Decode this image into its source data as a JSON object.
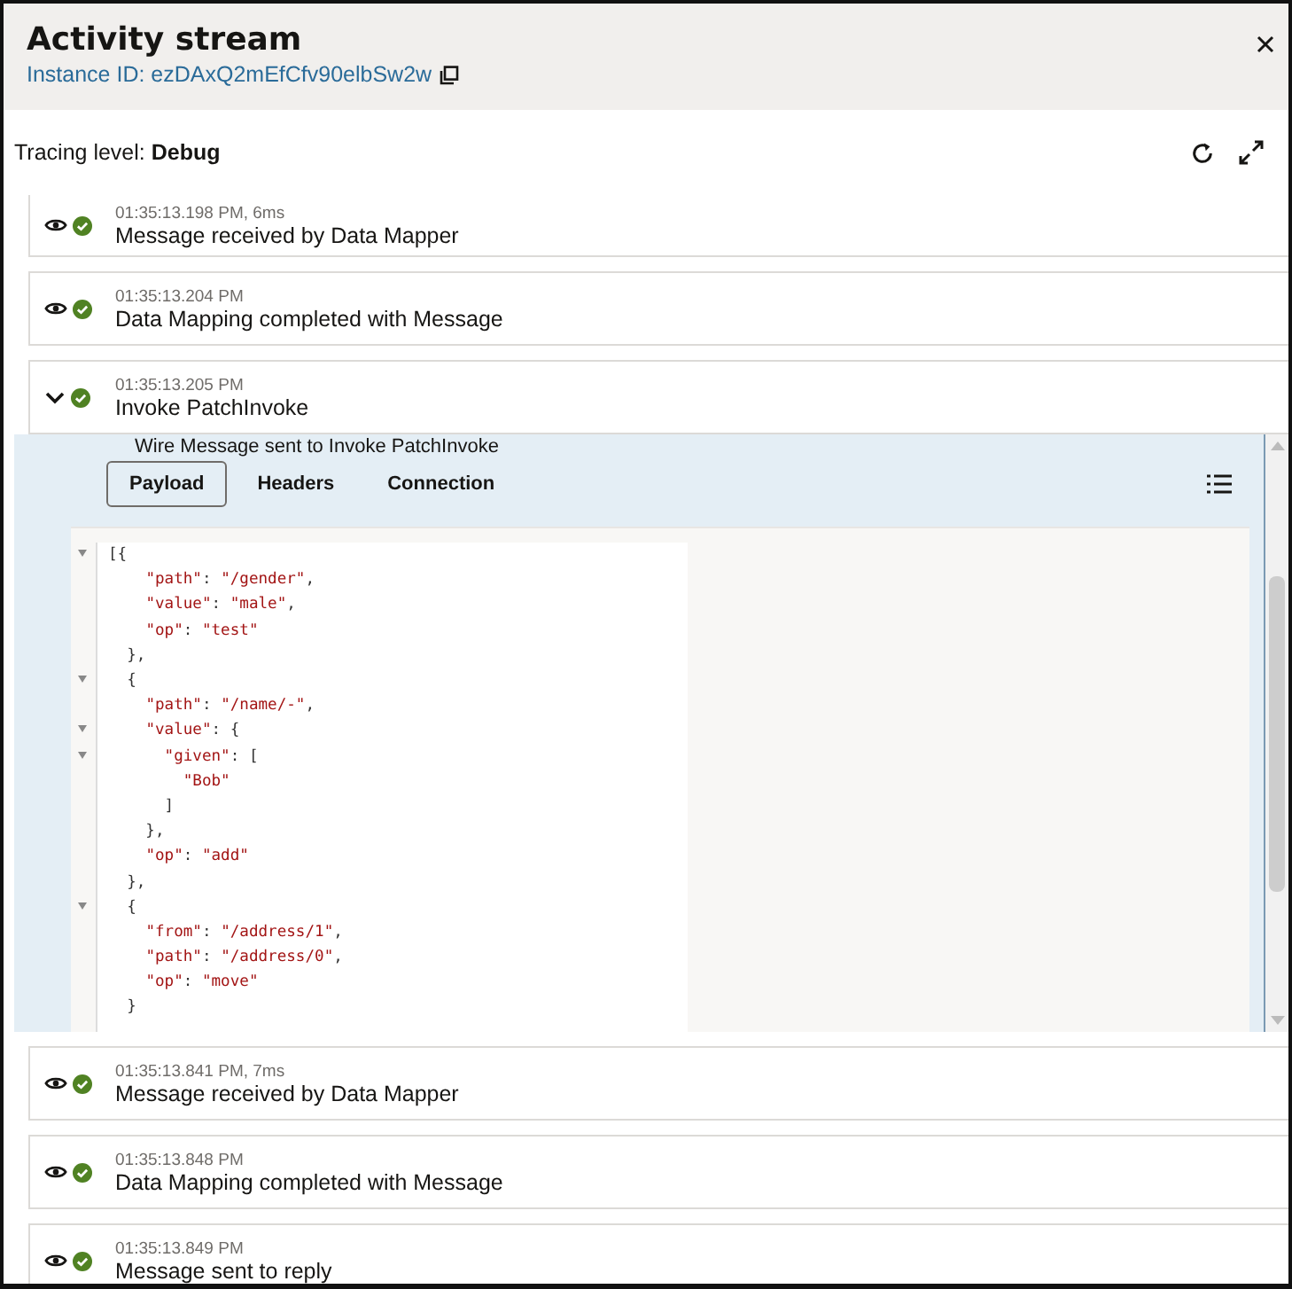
{
  "header": {
    "title": "Activity stream",
    "instance_label": "Instance ID: ezDAxQ2mEfCfv90elbSw2w"
  },
  "tracing": {
    "label": "Tracing level:",
    "value": "Debug"
  },
  "entries_before": [
    {
      "time": "01:35:13.198 PM, 6ms",
      "message": "Message received by Data Mapper",
      "expanded": false
    },
    {
      "time": "01:35:13.204 PM",
      "message": "Data Mapping completed with Message",
      "expanded": false
    },
    {
      "time": "01:35:13.205 PM",
      "message": "Invoke PatchInvoke",
      "expanded": true
    }
  ],
  "detail": {
    "subtitle": "Wire Message sent to Invoke PatchInvoke",
    "tabs": [
      {
        "label": "Payload",
        "selected": true
      },
      {
        "label": "Headers",
        "selected": false
      },
      {
        "label": "Connection",
        "selected": false
      }
    ],
    "code_lines": [
      {
        "text": "[{",
        "fold": true
      },
      {
        "text": "    \"path\": \"/gender\",",
        "fold": false
      },
      {
        "text": "    \"value\": \"male\",",
        "fold": false
      },
      {
        "text": "    \"op\": \"test\"",
        "fold": false
      },
      {
        "text": "  },",
        "fold": false
      },
      {
        "text": "  {",
        "fold": true
      },
      {
        "text": "    \"path\": \"/name/-\",",
        "fold": false
      },
      {
        "text": "    \"value\": {",
        "fold": true
      },
      {
        "text": "      \"given\": [",
        "fold": true
      },
      {
        "text": "        \"Bob\"",
        "fold": false
      },
      {
        "text": "      ]",
        "fold": false
      },
      {
        "text": "    },",
        "fold": false
      },
      {
        "text": "    \"op\": \"add\"",
        "fold": false
      },
      {
        "text": "  },",
        "fold": false
      },
      {
        "text": "  {",
        "fold": true
      },
      {
        "text": "    \"from\": \"/address/1\",",
        "fold": false
      },
      {
        "text": "    \"path\": \"/address/0\",",
        "fold": false
      },
      {
        "text": "    \"op\": \"move\"",
        "fold": false
      },
      {
        "text": "  }",
        "fold": false
      }
    ]
  },
  "entries_after": [
    {
      "time": "01:35:13.841 PM, 7ms",
      "message": "Message received by Data Mapper",
      "expanded": false
    },
    {
      "time": "01:35:13.848 PM",
      "message": "Data Mapping completed with Message",
      "expanded": false
    },
    {
      "time": "01:35:13.849 PM",
      "message": "Message sent to reply",
      "expanded": false
    }
  ]
}
